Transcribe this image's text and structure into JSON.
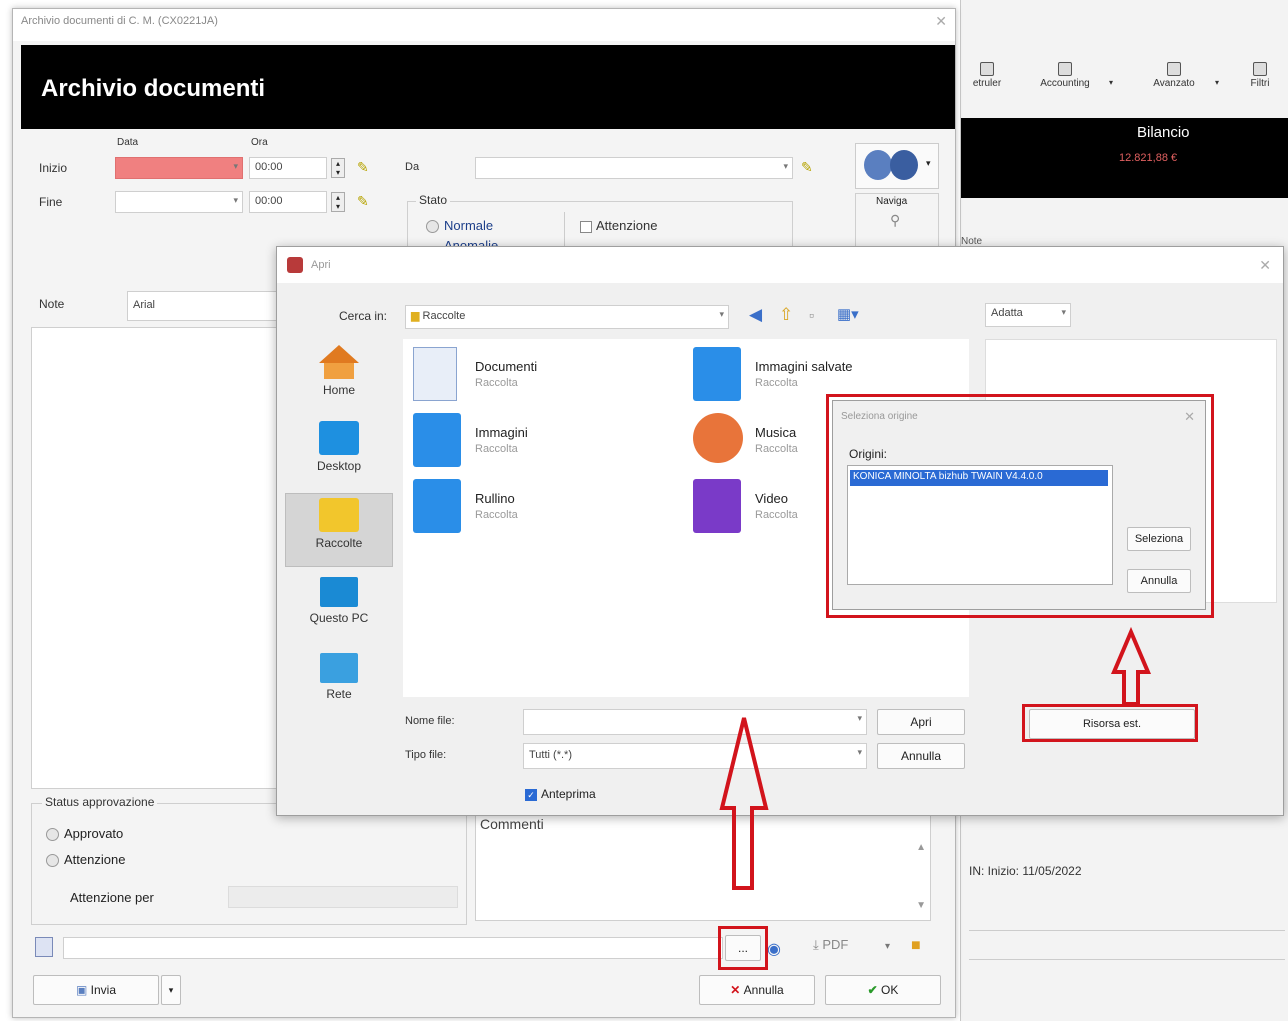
{
  "bg_app": {
    "ribbon": [
      {
        "label": "etruler"
      },
      {
        "label": "Accounting"
      },
      {
        "label": "Avanzato"
      },
      {
        "label": "Filtri"
      }
    ],
    "bilancio_label": "Bilancio",
    "bilancio_value": "12.821,88 €",
    "section_label": "Note",
    "status_text": "IN: Inizio: 11/05/2022"
  },
  "main": {
    "window_title": "Archivio documenti di C. M. (CX0221JA)",
    "header_title": "Archivio documenti",
    "col_data": "Data",
    "col_ora": "Ora",
    "inizio_label": "Inizio",
    "fine_label": "Fine",
    "inizio_time": "00:00",
    "fine_time": "00:00",
    "da_label": "Da",
    "stato_title": "Stato",
    "stato_normale": "Normale",
    "stato_anomalia": "Anomalie",
    "attenzione_label": "Attenzione",
    "naviga_label": "Naviga",
    "note_label": "Note",
    "note_value": "Arial",
    "approv_title": "Status approvazione",
    "approvato": "Approvato",
    "attenzione_radio": "Attenzione",
    "attenzione_per": "Attenzione per",
    "commenti": "Commenti",
    "pdf_label": "PDF",
    "invia": "Invia",
    "annulla": "Annulla",
    "ok": "OK"
  },
  "open_dialog": {
    "title": "Apri",
    "cerca_in_label": "Cerca in:",
    "cerca_in_value": "Raccolte",
    "adatta_label": "Adatta",
    "places": [
      {
        "label": "Home"
      },
      {
        "label": "Desktop"
      },
      {
        "label": "Raccolte"
      },
      {
        "label": "Questo PC"
      },
      {
        "label": "Rete"
      }
    ],
    "libraries": [
      {
        "name": "Documenti",
        "sub": "Raccolta"
      },
      {
        "name": "Immagini salvate",
        "sub": "Raccolta"
      },
      {
        "name": "Immagini",
        "sub": "Raccolta"
      },
      {
        "name": "Musica",
        "sub": "Raccolta"
      },
      {
        "name": "Rullino",
        "sub": "Raccolta"
      },
      {
        "name": "Video",
        "sub": "Raccolta"
      }
    ],
    "nome_file_label": "Nome file:",
    "tipo_file_label": "Tipo file:",
    "tipo_file_value": "Tutti (*.*)",
    "apri": "Apri",
    "annulla": "Annulla",
    "anteprima": "Anteprima",
    "risorsa_est": "Risorsa est."
  },
  "source_dialog": {
    "title": "Seleziona origine",
    "origini_label": "Origini:",
    "selected": "KONICA MINOLTA bizhub TWAIN V4.4.0.0",
    "seleziona": "Seleziona",
    "annulla": "Annulla"
  },
  "colors": {
    "annotation_red": "#d2141c",
    "header_black": "#000000",
    "date_field_red": "#f08080",
    "selection_blue": "#2a6ad4"
  }
}
